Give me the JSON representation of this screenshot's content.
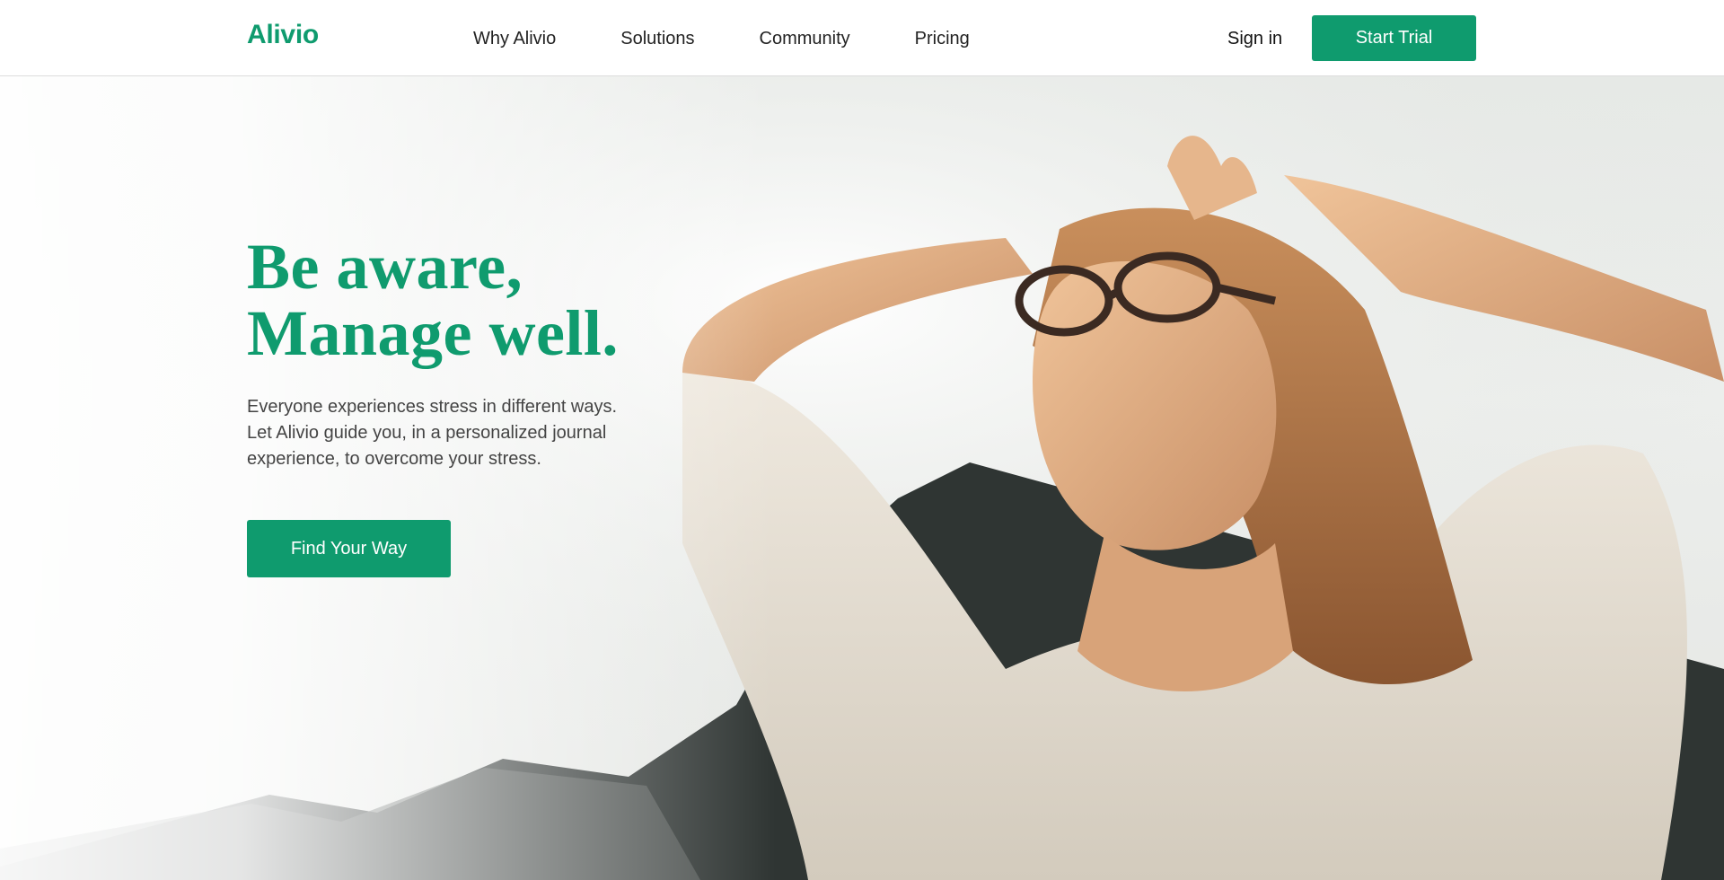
{
  "brand": {
    "logo_text": "Alivio",
    "accent_color": "#0f9b6e"
  },
  "nav": {
    "links": [
      {
        "label": "Why Alivio"
      },
      {
        "label": "Solutions"
      },
      {
        "label": "Community"
      },
      {
        "label": "Pricing"
      }
    ],
    "sign_in_label": "Sign in",
    "trial_button_label": "Start Trial"
  },
  "hero": {
    "headline_line1": "Be aware,",
    "headline_line2": "Manage well.",
    "description": "Everyone experiences stress in different ways. Let Alivio guide you, in a personalized journal experience, to overcome your stress.",
    "cta_label": "Find Your Way",
    "image_subject": "woman-relaxing-in-sunlight-photo"
  }
}
